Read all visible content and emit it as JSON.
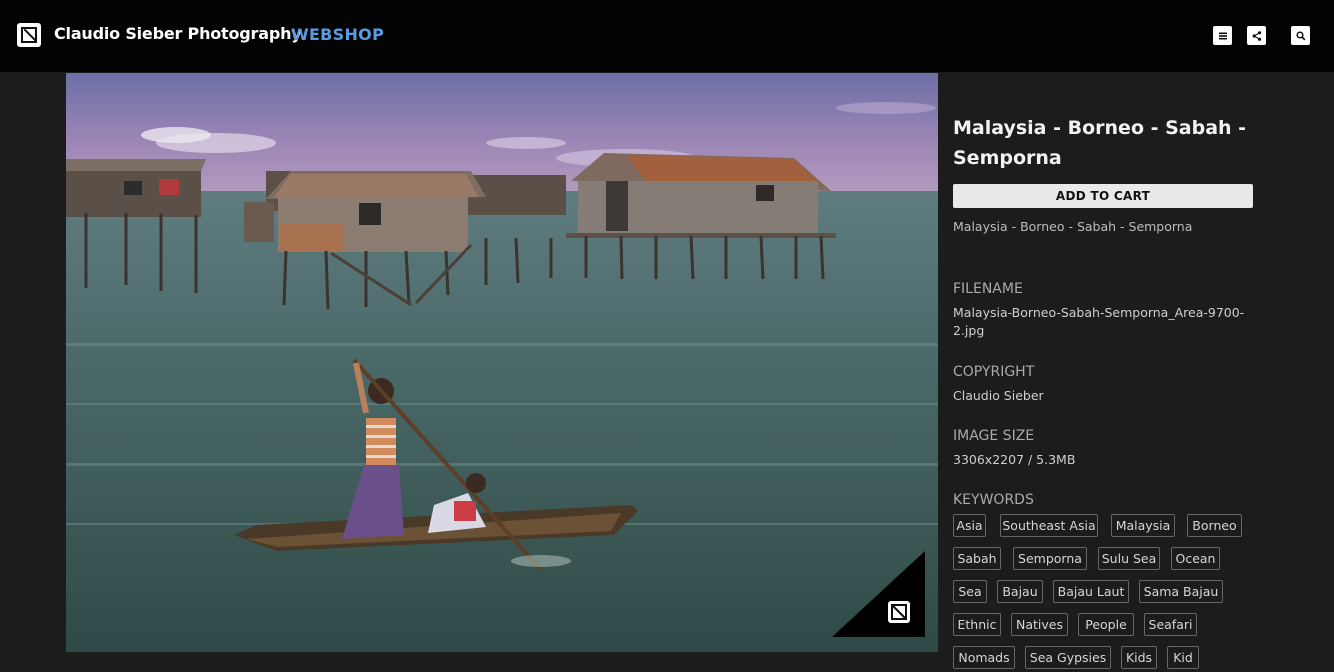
{
  "header": {
    "site_title": "Claudio Sieber Photography",
    "shop_label": "WEBSHOP",
    "buttons": [
      {
        "name": "menu-icon"
      },
      {
        "name": "share-icon"
      },
      {
        "name": "search-icon"
      }
    ]
  },
  "photo": {
    "alt": "Malaysia - Borneo - Sabah - Semporna"
  },
  "details": {
    "title": "Malaysia - Borneo - Sabah - Semporna",
    "cart_label": "ADD TO CART",
    "description": "Malaysia - Borneo - Sabah - Semporna",
    "filename_label": "FILENAME",
    "filename": "Malaysia-Borneo-Sabah-Semporna_Area-9700-2.jpg",
    "copyright_label": "COPYRIGHT",
    "copyright": "Claudio Sieber",
    "size_label": "IMAGE SIZE",
    "size": "3306x2207 / 5.3MB",
    "keywords_label": "KEYWORDS",
    "keywords": [
      "Asia",
      "Southeast Asia",
      "Malaysia",
      "Borneo",
      "Sabah",
      "Semporna",
      "Sulu Sea",
      "Ocean",
      "Sea",
      "Bajau",
      "Bajau Laut",
      "Sama Bajau",
      "Ethnic",
      "Natives",
      "People",
      "Seafari",
      "Nomads",
      "Sea Gypsies",
      "Kids",
      "Kid"
    ]
  },
  "colors": {
    "background": "#1c1c1c",
    "topbar": "#030303",
    "accent": "#5b9be0"
  }
}
